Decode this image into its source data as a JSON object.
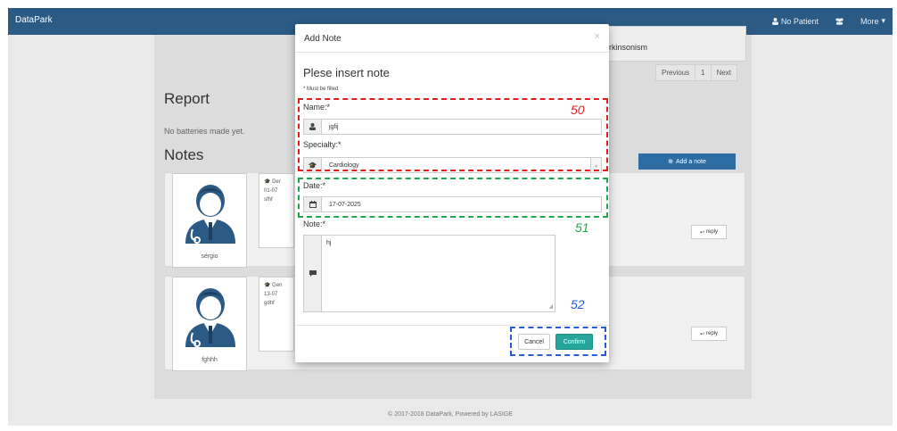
{
  "navbar": {
    "brand": "DataPark",
    "patient_label": "No Patient",
    "more_label": "More"
  },
  "background_card": {
    "text": "parkinsonism",
    "pagination": [
      "Previous",
      "1",
      "Next"
    ]
  },
  "report": {
    "title": "Report",
    "no_batteries": "No batteries made yet."
  },
  "notes": {
    "title": "Notes",
    "add_button": "Add a note",
    "items": [
      {
        "author": "sérgio",
        "specialty": "Der",
        "date": "01-07",
        "text": "sfhf",
        "reply_label": "reply"
      },
      {
        "author": "fghhh",
        "specialty": "Gen",
        "date": "13-07",
        "text": "gdhf",
        "reply_label": "reply"
      }
    ]
  },
  "footer": {
    "text": "© 2017-2018 DataPark, Powered by LASIGE"
  },
  "modal": {
    "title": "Add Note",
    "close_symbol": "×",
    "heading": "Plese insert note",
    "required_note": "* Must be filled",
    "name_label": "Name:*",
    "name_value": "jgfij",
    "specialty_label": "Specialty:*",
    "specialty_value": "Cardiology",
    "date_label": "Date:*",
    "date_value": "17-07-2025",
    "note_label": "Note:*",
    "note_value": "hj",
    "cancel_label": "Cancel",
    "confirm_label": "Confirm"
  },
  "annotations": [
    {
      "label": "50",
      "color": "#e02020"
    },
    {
      "label": "51",
      "color": "#1fa84f"
    },
    {
      "label": "52",
      "color": "#2a5bd7"
    }
  ],
  "colors": {
    "navbar": "#2b5a85",
    "primary_button": "#2e6da4",
    "confirm_button": "#26a69a"
  }
}
